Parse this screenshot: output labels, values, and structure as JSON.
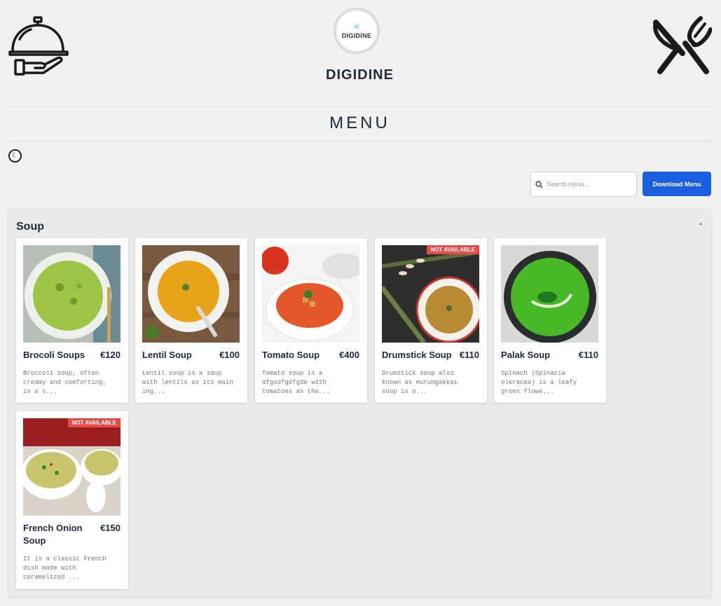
{
  "header": {
    "waiter_icon": "serving-cloche-hand-icon",
    "cutlery_icon": "fork-knife-icon",
    "logo_text": "DIGIDINE",
    "brand": "DIGIDINE"
  },
  "menu_title": "MENU",
  "theme_toggle_icon": "moon-icon",
  "search": {
    "placeholder": "Search menu...",
    "icon": "search-icon"
  },
  "download_label": "Download Menu",
  "colors": {
    "accent": "#1b5fe0",
    "badge": "#e94b4b",
    "background": "#f1f1f1"
  },
  "section": {
    "title": "Soup",
    "items": [
      {
        "name": "Brocoli Soups",
        "price": "€120",
        "desc": "Broccoli soup, often creamy and comforting, is a s...",
        "available": true
      },
      {
        "name": "Lentil Soup",
        "price": "€100",
        "desc": "Lentil soup is a soup with lentils as its main ing...",
        "available": true
      },
      {
        "name": "Tomato Soup",
        "price": "€400",
        "desc": "Tomato soup is a dfgsdfgdfgde with tomatoes as the...",
        "available": true
      },
      {
        "name": "Drumstick Soup",
        "price": "€110",
        "desc": "Drumstick soup also known as murungakkai soup is o...",
        "available": false,
        "badge": "NOT AVAILABLE"
      },
      {
        "name": "Palak Soup",
        "price": "€110",
        "desc": "Spinach (Spinacia oleracea) is a leafy green flowe...",
        "available": true
      },
      {
        "name": "French Onion Soup",
        "price": "€150",
        "desc": "It is a classic French dish made with caramelized ...",
        "available": false,
        "badge": "NOT AVAILABLE"
      }
    ]
  }
}
